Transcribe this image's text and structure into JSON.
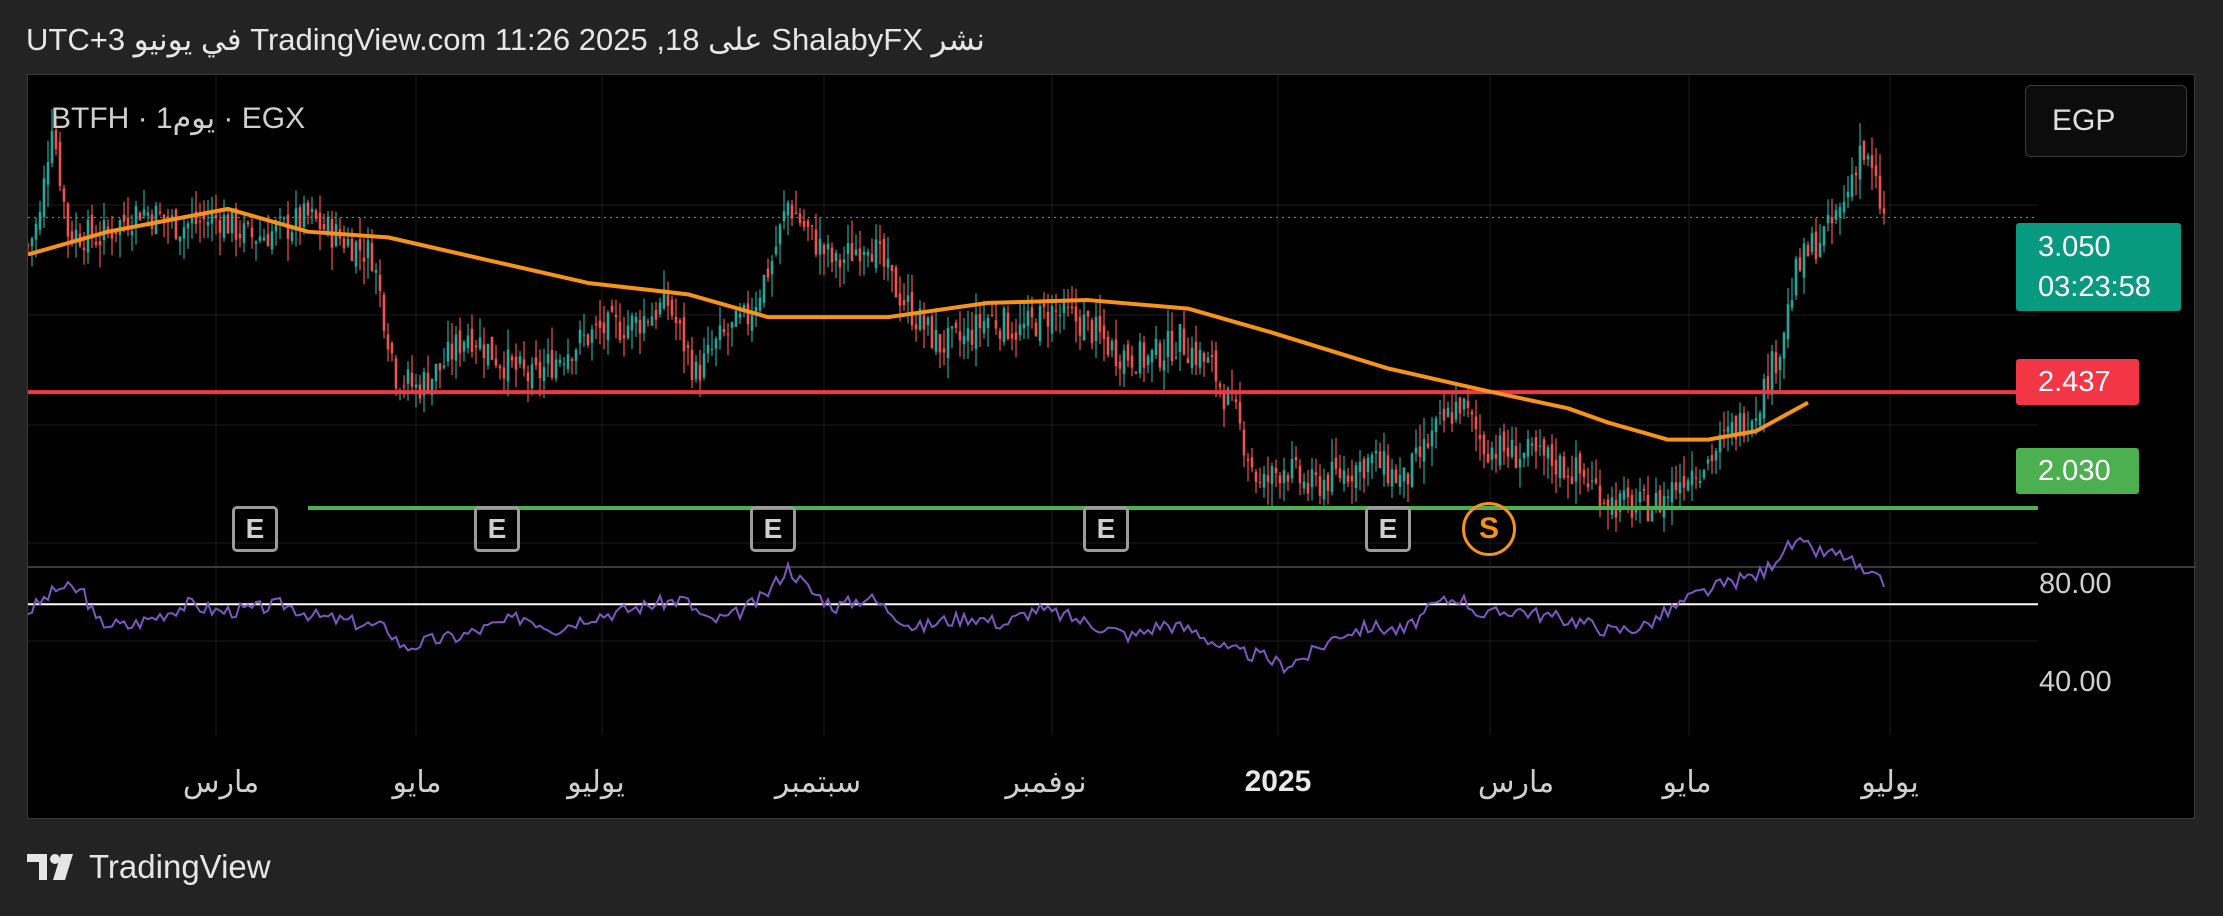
{
  "header": {
    "text": "نشر ShalabyFX على TradingView.com 11:26 2025 ,18 في يونيو UTC+3"
  },
  "chart": {
    "symbol_label": "BTFH · 1يوم · EGX",
    "currency": "EGP"
  },
  "price_tags": {
    "last_price": "3.050",
    "countdown": "03:23:58",
    "red_level": "2.437",
    "green_level": "2.030"
  },
  "rsi": {
    "upper_label": "80.00",
    "lower_label": "40.00"
  },
  "events": {
    "earnings": [
      "E",
      "E",
      "E",
      "E",
      "E"
    ],
    "split": "S"
  },
  "footer": {
    "brand": "TradingView"
  },
  "colors": {
    "up": "#26a69a",
    "down": "#ef5350",
    "moving_average": "#f7931a",
    "resistance_line": "#f23645",
    "support_line": "#4caf50",
    "rsi_line": "#7e57c2"
  },
  "chart_data": {
    "type": "candlestick",
    "x_axis": {
      "ticks": [
        "مارس",
        "مايو",
        "يوليو",
        "سبتمبر",
        "نوفمبر",
        "2025",
        "مارس",
        "مايو",
        "يوليو"
      ]
    },
    "y_range": [
      1.83,
      3.55
    ],
    "horizontal_levels": [
      {
        "name": "resistance",
        "value": 2.437
      },
      {
        "name": "support",
        "value": 2.03
      }
    ],
    "last_price": 3.05,
    "close_anchors": [
      [
        0,
        2.95
      ],
      [
        3,
        3.05
      ],
      [
        6,
        3.4
      ],
      [
        10,
        3.0
      ],
      [
        18,
        2.98
      ],
      [
        28,
        3.08
      ],
      [
        38,
        3.02
      ],
      [
        48,
        3.05
      ],
      [
        55,
        2.98
      ],
      [
        62,
        3.0
      ],
      [
        70,
        3.05
      ],
      [
        78,
        2.98
      ],
      [
        86,
        2.92
      ],
      [
        92,
        2.5
      ],
      [
        97,
        2.45
      ],
      [
        103,
        2.52
      ],
      [
        110,
        2.65
      ],
      [
        118,
        2.55
      ],
      [
        126,
        2.48
      ],
      [
        134,
        2.58
      ],
      [
        142,
        2.65
      ],
      [
        152,
        2.68
      ],
      [
        160,
        2.75
      ],
      [
        167,
        2.5
      ],
      [
        173,
        2.62
      ],
      [
        180,
        2.7
      ],
      [
        186,
        2.9
      ],
      [
        190,
        3.1
      ],
      [
        196,
        2.98
      ],
      [
        202,
        2.88
      ],
      [
        210,
        2.98
      ],
      [
        216,
        2.82
      ],
      [
        222,
        2.7
      ],
      [
        228,
        2.6
      ],
      [
        234,
        2.62
      ],
      [
        240,
        2.7
      ],
      [
        248,
        2.65
      ],
      [
        256,
        2.72
      ],
      [
        264,
        2.68
      ],
      [
        272,
        2.58
      ],
      [
        280,
        2.55
      ],
      [
        288,
        2.62
      ],
      [
        296,
        2.52
      ],
      [
        302,
        2.35
      ],
      [
        308,
        2.1
      ],
      [
        314,
        2.18
      ],
      [
        320,
        2.1
      ],
      [
        328,
        2.15
      ],
      [
        336,
        2.2
      ],
      [
        344,
        2.12
      ],
      [
        352,
        2.3
      ],
      [
        358,
        2.4
      ],
      [
        364,
        2.25
      ],
      [
        372,
        2.22
      ],
      [
        380,
        2.2
      ],
      [
        388,
        2.15
      ],
      [
        396,
        2.05
      ],
      [
        402,
        2.03
      ],
      [
        408,
        2.05
      ],
      [
        414,
        2.15
      ],
      [
        420,
        2.2
      ],
      [
        426,
        2.3
      ],
      [
        432,
        2.38
      ],
      [
        438,
        2.6
      ],
      [
        442,
        2.85
      ],
      [
        446,
        2.95
      ],
      [
        450,
        3.0
      ],
      [
        454,
        3.1
      ],
      [
        458,
        3.3
      ],
      [
        461,
        3.2
      ],
      [
        464,
        3.05
      ]
    ],
    "moving_average": [
      [
        0,
        2.92
      ],
      [
        20,
        3.0
      ],
      [
        50,
        3.08
      ],
      [
        70,
        3.0
      ],
      [
        90,
        2.98
      ],
      [
        115,
        2.9
      ],
      [
        140,
        2.82
      ],
      [
        165,
        2.78
      ],
      [
        185,
        2.7
      ],
      [
        215,
        2.7
      ],
      [
        240,
        2.75
      ],
      [
        265,
        2.76
      ],
      [
        290,
        2.73
      ],
      [
        310,
        2.65
      ],
      [
        340,
        2.52
      ],
      [
        365,
        2.44
      ],
      [
        385,
        2.38
      ],
      [
        395,
        2.33
      ],
      [
        410,
        2.27
      ],
      [
        420,
        2.27
      ],
      [
        432,
        2.3
      ],
      [
        445,
        2.4
      ]
    ],
    "rsi": {
      "level_line": 55,
      "upper": 80,
      "lower": 40,
      "anchors": [
        [
          0,
          52
        ],
        [
          8,
          62
        ],
        [
          14,
          60
        ],
        [
          17,
          48
        ],
        [
          25,
          46
        ],
        [
          32,
          50
        ],
        [
          40,
          55
        ],
        [
          48,
          52
        ],
        [
          56,
          53
        ],
        [
          64,
          55
        ],
        [
          72,
          50
        ],
        [
          80,
          48
        ],
        [
          90,
          45
        ],
        [
          94,
          37
        ],
        [
          100,
          40
        ],
        [
          108,
          42
        ],
        [
          116,
          46
        ],
        [
          124,
          50
        ],
        [
          132,
          45
        ],
        [
          140,
          50
        ],
        [
          148,
          52
        ],
        [
          156,
          55
        ],
        [
          164,
          57
        ],
        [
          170,
          48
        ],
        [
          176,
          50
        ],
        [
          184,
          58
        ],
        [
          190,
          70
        ],
        [
          196,
          60
        ],
        [
          202,
          54
        ],
        [
          210,
          58
        ],
        [
          216,
          52
        ],
        [
          222,
          45
        ],
        [
          228,
          48
        ],
        [
          236,
          50
        ],
        [
          244,
          47
        ],
        [
          252,
          53
        ],
        [
          260,
          50
        ],
        [
          268,
          46
        ],
        [
          276,
          42
        ],
        [
          284,
          47
        ],
        [
          292,
          44
        ],
        [
          300,
          36
        ],
        [
          308,
          34
        ],
        [
          314,
          30
        ],
        [
          320,
          34
        ],
        [
          328,
          43
        ],
        [
          336,
          46
        ],
        [
          344,
          44
        ],
        [
          352,
          55
        ],
        [
          358,
          58
        ],
        [
          364,
          50
        ],
        [
          372,
          53
        ],
        [
          380,
          50
        ],
        [
          388,
          48
        ],
        [
          396,
          44
        ],
        [
          404,
          46
        ],
        [
          410,
          52
        ],
        [
          416,
          58
        ],
        [
          422,
          62
        ],
        [
          428,
          65
        ],
        [
          434,
          68
        ],
        [
          438,
          76
        ],
        [
          442,
          80
        ],
        [
          448,
          76
        ],
        [
          454,
          75
        ],
        [
          460,
          66
        ],
        [
          464,
          64
        ]
      ]
    }
  }
}
